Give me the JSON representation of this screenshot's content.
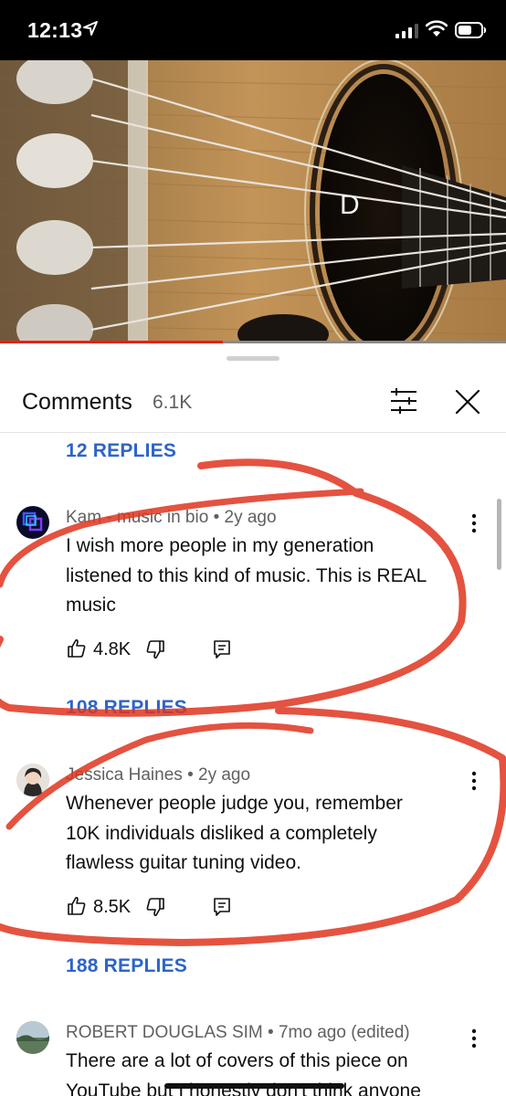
{
  "status_bar": {
    "time": "12:13",
    "icons": [
      "location-arrow-icon",
      "signal-icon",
      "wifi-icon",
      "battery-icon"
    ]
  },
  "video": {
    "overlay_letter": "D",
    "progress": 0.44,
    "accent_color": "#e62117"
  },
  "comments_panel": {
    "title": "Comments",
    "count": "6.1K",
    "icons": [
      "filter-icon",
      "close-icon"
    ]
  },
  "threads": [
    {
      "replies_label": "12 REPLIES"
    },
    {
      "author": "Kam - music in bio",
      "age": "2y ago",
      "body_lines": [
        "I wish more people in my generation",
        "listened to this kind of music. This is REAL",
        "music"
      ],
      "likes": "4.8K",
      "replies_label": "108 REPLIES"
    },
    {
      "author": "Jessica Haines",
      "age": "2y ago",
      "body_lines": [
        "Whenever people judge you, remember",
        "10K individuals disliked a completely",
        "flawless guitar tuning video."
      ],
      "likes": "8.5K",
      "replies_label": "188 REPLIES"
    },
    {
      "author": "ROBERT DOUGLAS SIM",
      "age": "7mo ago (edited)",
      "body_lines": [
        "There are a lot of covers of this piece on",
        "YouTube but I honestly don't think anyone"
      ]
    }
  ],
  "colors": {
    "link_blue": "#2d64c8",
    "annotation_red": "#e0351f",
    "meta_gray": "#606060"
  }
}
